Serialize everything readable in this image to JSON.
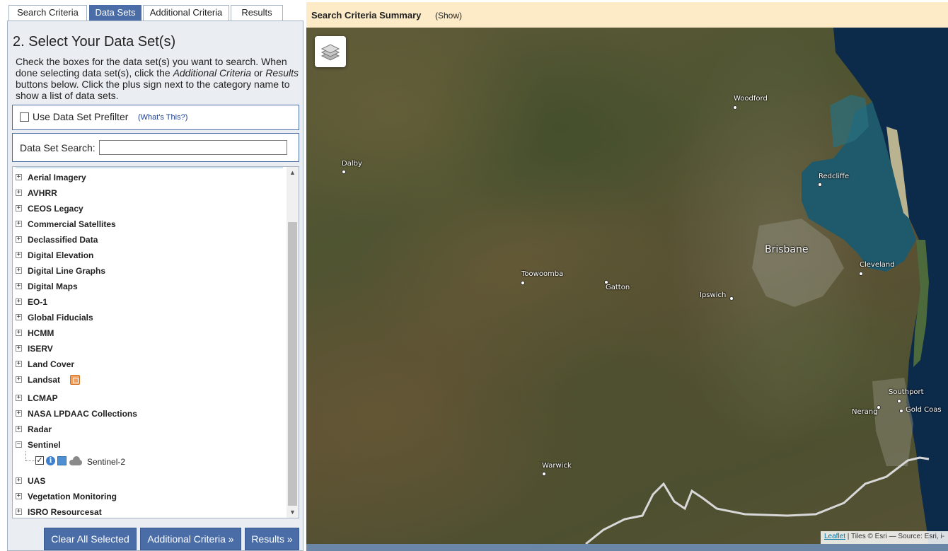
{
  "tabs": [
    {
      "label": "Search Criteria",
      "active": false
    },
    {
      "label": "Data Sets",
      "active": true
    },
    {
      "label": "Additional Criteria",
      "active": false
    },
    {
      "label": "Results",
      "active": false
    }
  ],
  "panel": {
    "heading": "2. Select Your Data Set(s)",
    "instructions": {
      "part1": "Check the boxes for the data set(s) you want to search. When done selecting data set(s), click the ",
      "em1": "Additional Criteria",
      "part2": " or ",
      "em2": "Results",
      "part3": " buttons below. Click the plus sign next to the category name to show a list of data sets."
    },
    "prefilter": {
      "label": "Use Data Set Prefilter",
      "help": "(What's This?)",
      "checked": false
    },
    "search": {
      "label": "Data Set Search:",
      "value": ""
    }
  },
  "tree": {
    "categories": [
      {
        "label": "Aerial Imagery",
        "expander": "+"
      },
      {
        "label": "AVHRR",
        "expander": "+"
      },
      {
        "label": "CEOS Legacy",
        "expander": "+"
      },
      {
        "label": "Commercial Satellites",
        "expander": "+"
      },
      {
        "label": "Declassified Data",
        "expander": "+"
      },
      {
        "label": "Digital Elevation",
        "expander": "+"
      },
      {
        "label": "Digital Line Graphs",
        "expander": "+"
      },
      {
        "label": "Digital Maps",
        "expander": "+"
      },
      {
        "label": "EO-1",
        "expander": "+"
      },
      {
        "label": "Global Fiducials",
        "expander": "+"
      },
      {
        "label": "HCMM",
        "expander": "+"
      },
      {
        "label": "ISERV",
        "expander": "+"
      },
      {
        "label": "Land Cover",
        "expander": "+"
      },
      {
        "label": "Landsat",
        "expander": "+"
      },
      {
        "label": "LCMAP",
        "expander": "+"
      },
      {
        "label": "NASA LPDAAC Collections",
        "expander": "+"
      },
      {
        "label": "Radar",
        "expander": "+"
      },
      {
        "label": "Sentinel",
        "expander": "−"
      },
      {
        "label": "UAS",
        "expander": "+"
      },
      {
        "label": "Vegetation Monitoring",
        "expander": "+"
      },
      {
        "label": "ISRO Resourcesat",
        "expander": "+"
      }
    ],
    "sentinel_child": {
      "label": "Sentinel-2",
      "checked": true,
      "checkmark": "✓",
      "info_glyph": "i",
      "icons": [
        "info-icon",
        "footprint-icon",
        "cloud-icon"
      ]
    }
  },
  "buttons": {
    "clear": "Clear All Selected",
    "additional": "Additional Criteria »",
    "results": "Results »"
  },
  "summary": {
    "title": "Search Criteria Summary",
    "toggle": "(Show)"
  },
  "map": {
    "cities": [
      {
        "name": "Woodford"
      },
      {
        "name": "Dalby"
      },
      {
        "name": "Redcliffe"
      },
      {
        "name": "Brisbane"
      },
      {
        "name": "Toowoomba"
      },
      {
        "name": "Gatton"
      },
      {
        "name": "Ipswich"
      },
      {
        "name": "Cleveland"
      },
      {
        "name": "Southport"
      },
      {
        "name": "Nerang"
      },
      {
        "name": "Gold Coas"
      },
      {
        "name": "Warwick"
      }
    ],
    "attribution": {
      "link": "Leaflet",
      "text": " | Tiles © Esri — Source: Esri, i-"
    }
  }
}
